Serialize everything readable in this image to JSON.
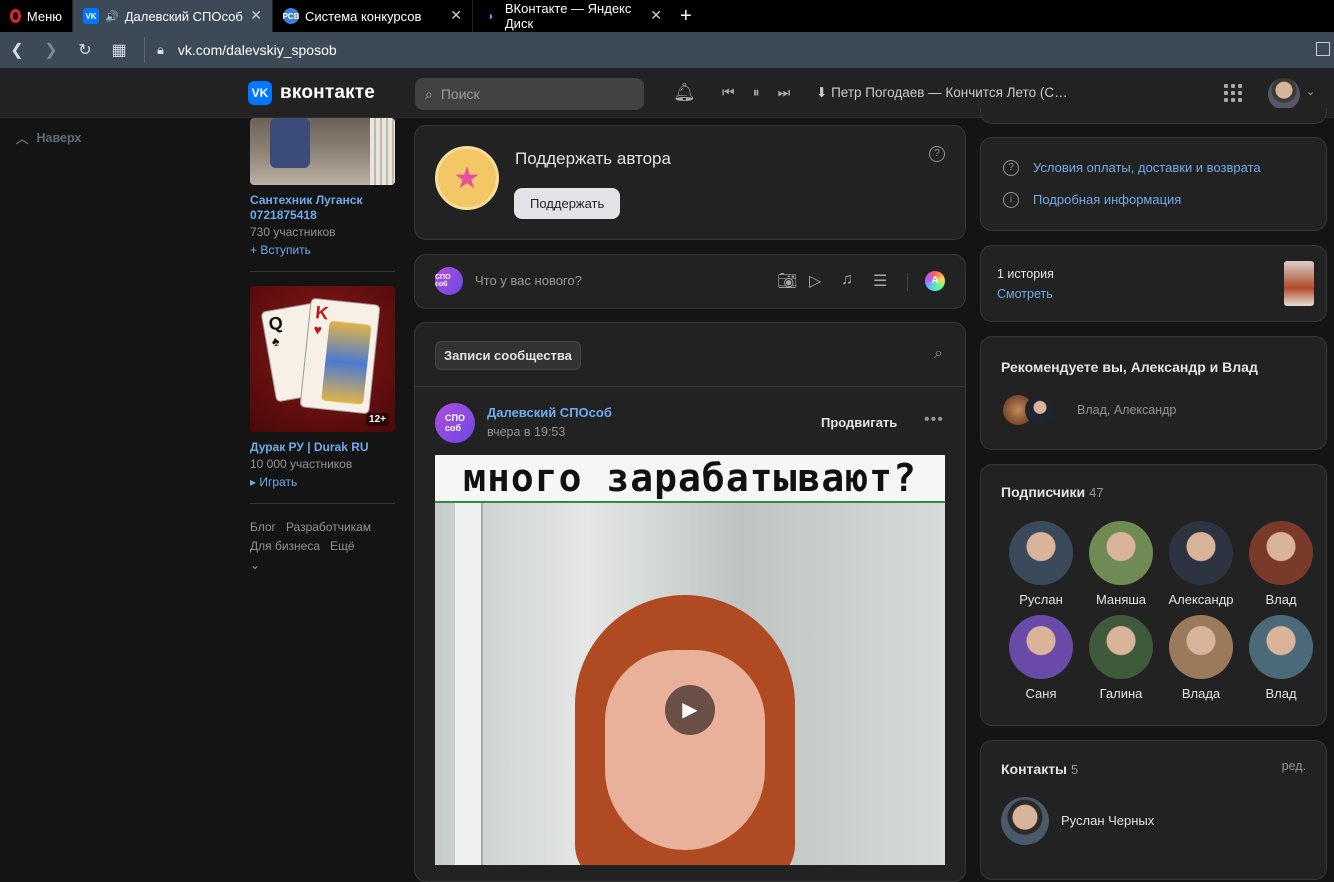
{
  "browser": {
    "menu_label": "Меню",
    "tabs": [
      {
        "label": "Далевский СПОсоб",
        "active": true,
        "favicon": "vk"
      },
      {
        "label": "Система конкурсов",
        "active": false,
        "favicon": "рсв"
      },
      {
        "label": "ВКонтакте — Яндекс Диск",
        "active": false,
        "favicon": "disk"
      }
    ],
    "url": "vk.com/dalevskiy_sposob"
  },
  "header": {
    "logo_text": "вконтакте",
    "search_placeholder": "Поиск",
    "now_playing": "Петр Погодаев — Кончится Лето (С…"
  },
  "left_nav": {
    "back_to_top": "Наверх"
  },
  "groups": [
    {
      "name": "Сантехник Луганск 0721875418",
      "members": "730 участников",
      "action": "Вступить"
    },
    {
      "name": "Дурак РУ | Durak RU",
      "members": "10 000 участников",
      "action": "Играть",
      "age_badge": "12+"
    }
  ],
  "footer_links": [
    "Блог",
    "Разработчикам",
    "Для бизнеса",
    "Ещё"
  ],
  "donate": {
    "title": "Поддержать автора",
    "button": "Поддержать"
  },
  "composer": {
    "placeholder": "Что у вас нового?",
    "avatar_text": "СПО соб"
  },
  "wall": {
    "tab": "Записи сообщества",
    "post": {
      "author": "Далевский СПОсоб",
      "time": "вчера в 19:53",
      "promote": "Продвигать",
      "video_caption": "много зарабатывают?"
    }
  },
  "right": {
    "links": [
      "Условия оплаты, доставки и возврата",
      "Подробная информация"
    ],
    "stories": {
      "count": "1 история",
      "action": "Смотреть"
    },
    "recommend": {
      "title": "Рекомендуете вы, Александр и Влад",
      "names": "Влад, Александр"
    },
    "subscribers": {
      "title": "Подписчики",
      "count": "47",
      "items": [
        {
          "name": "Руслан",
          "color": "#3a4a5a"
        },
        {
          "name": "Маняша",
          "color": "#6f8a52"
        },
        {
          "name": "Александр",
          "color": "#2d3340"
        },
        {
          "name": "Влад",
          "color": "#7a3a2a"
        },
        {
          "name": "Саня",
          "color": "#6a4aa8"
        },
        {
          "name": "Галина",
          "color": "#3e5a3a"
        },
        {
          "name": "Влада",
          "color": "#9a7a5a"
        },
        {
          "name": "Влад",
          "color": "#4a6a7a"
        }
      ]
    },
    "contacts": {
      "title": "Контакты",
      "count": "5",
      "edit": "ред.",
      "first": "Руслан Черных"
    }
  },
  "colors": {
    "accent": "#71aaeb",
    "vk_blue": "#0077ff",
    "card_bg": "#222222",
    "page_bg": "#141414"
  }
}
